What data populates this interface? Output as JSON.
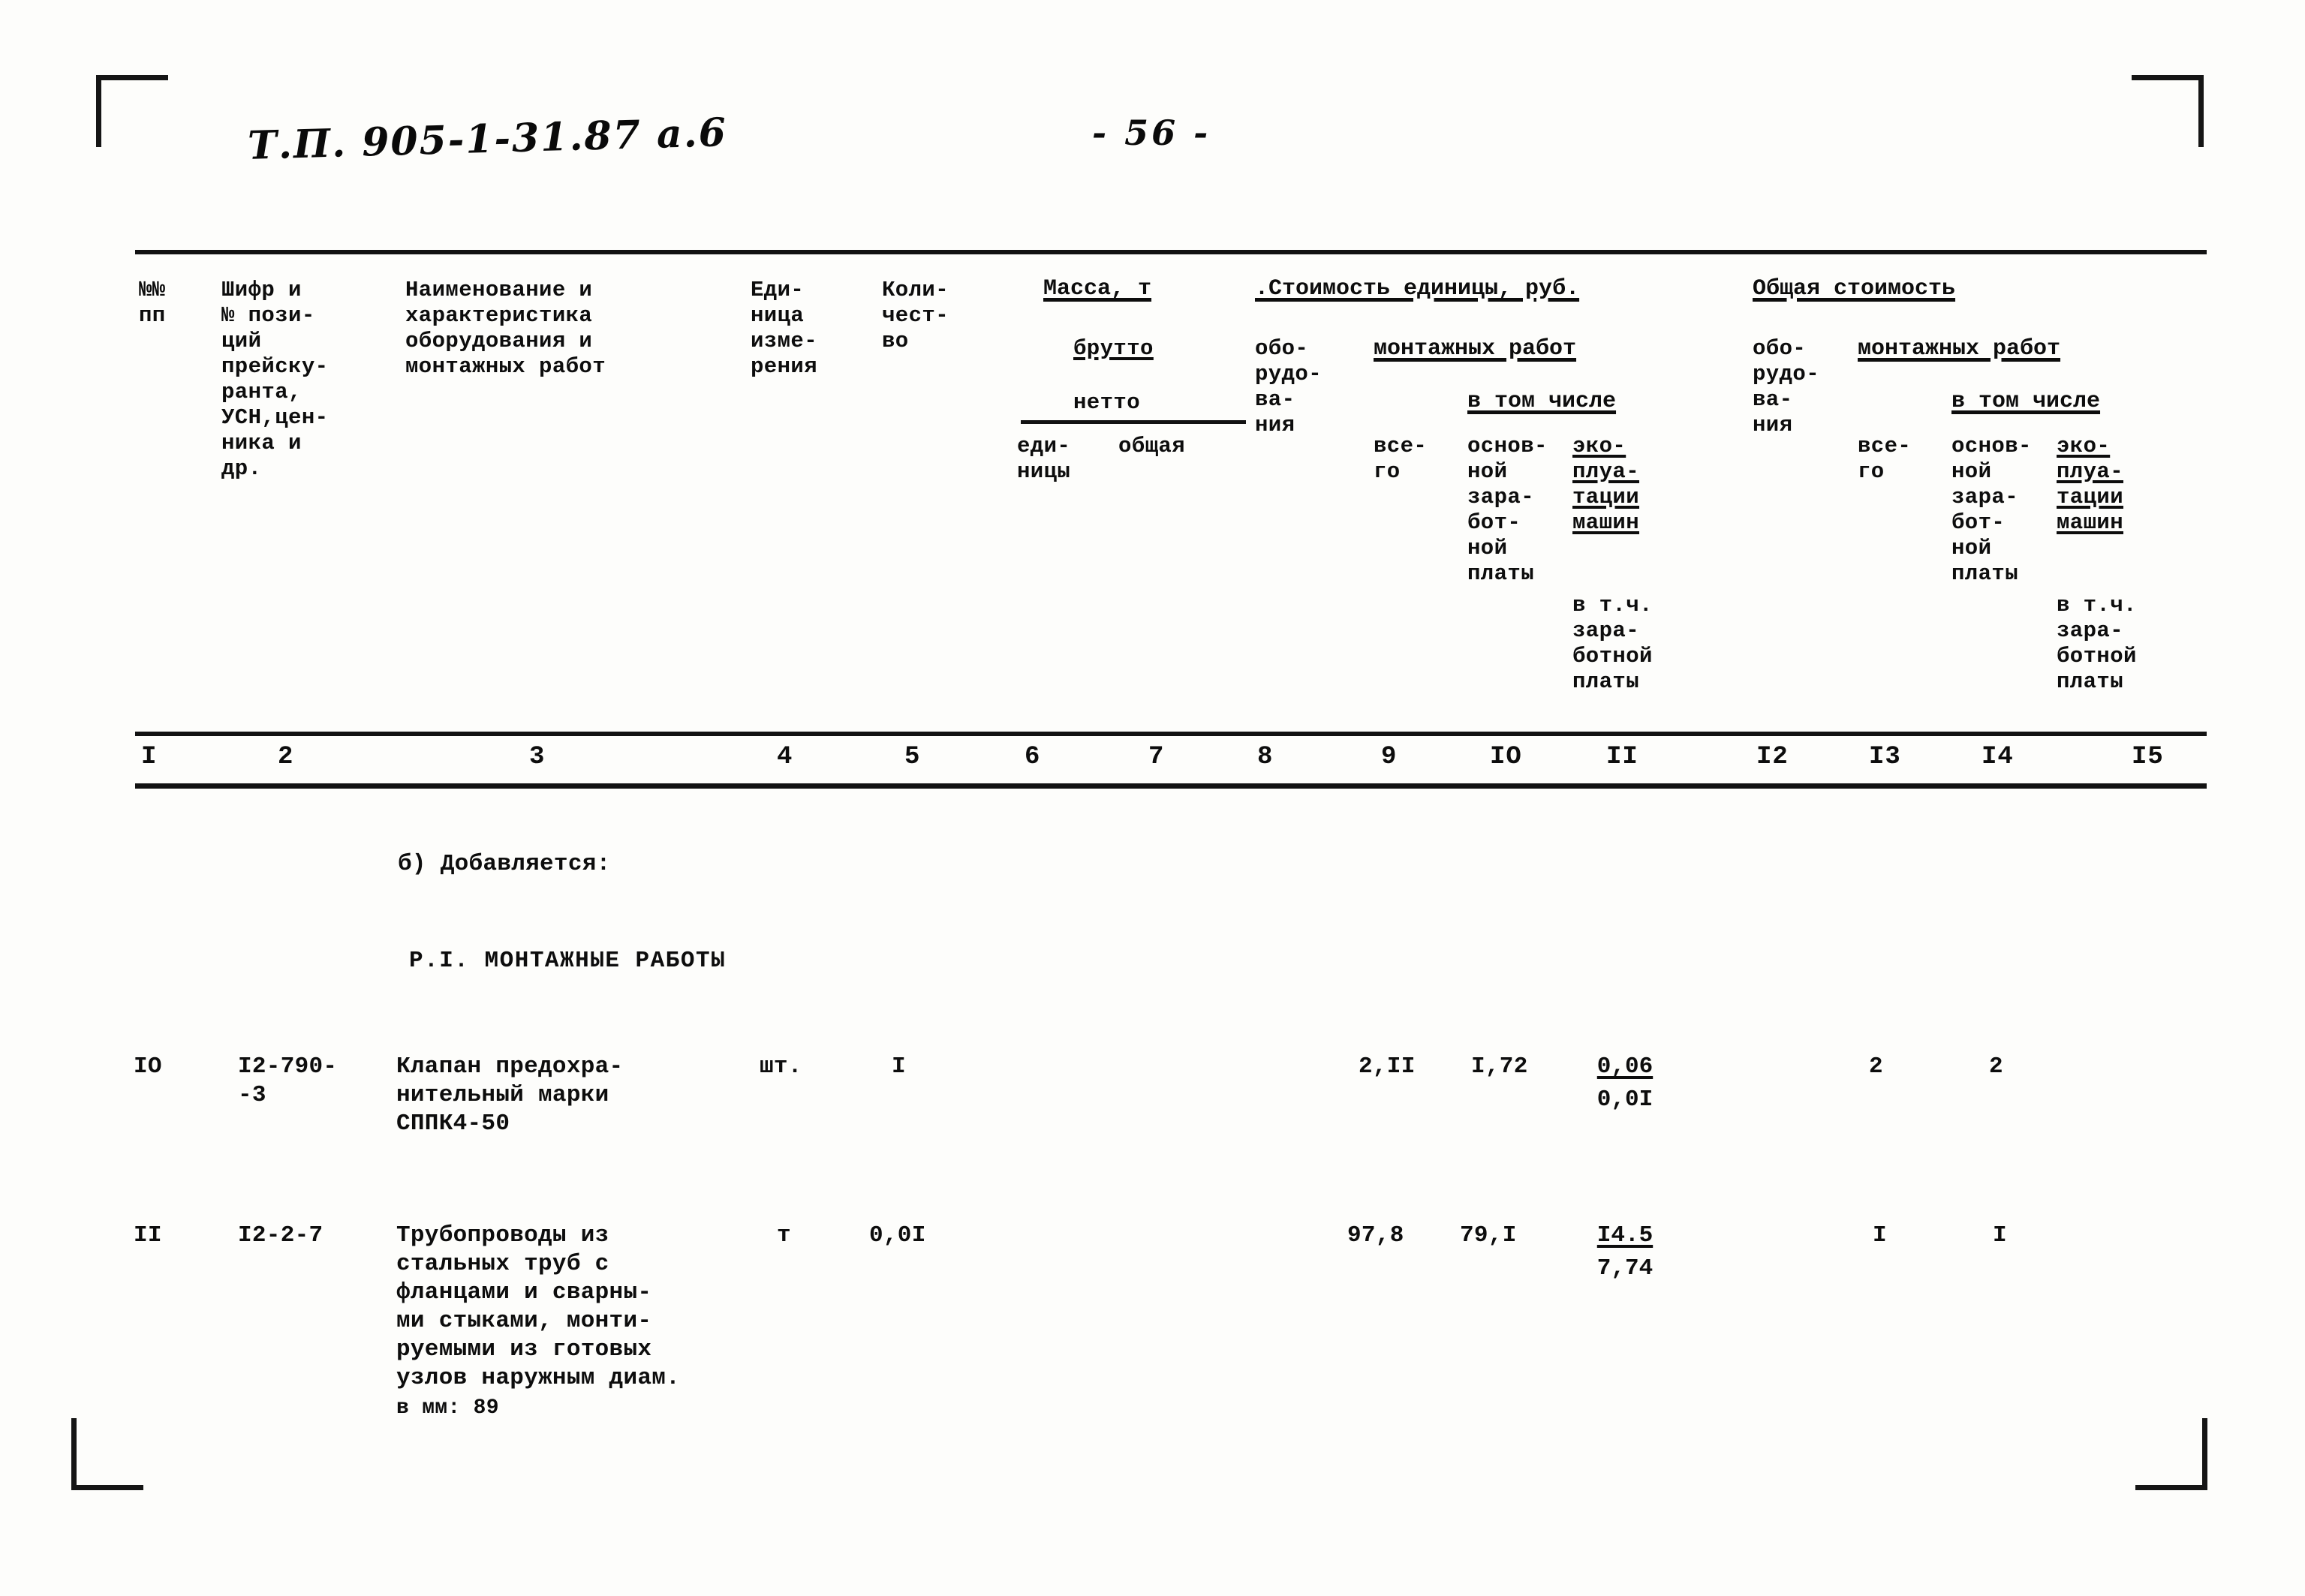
{
  "document": {
    "code": "Т.П. 905-1-31.87 а.6",
    "page_label": "- 56 -"
  },
  "table": {
    "headers": {
      "col1": "№№\nпп",
      "col2": "Шифр и\n№ пози-\nций\nпрейску-\nранта,\nУСН,цен-\nника и\nдр.",
      "col3": "Наименование и\nхарактеристика\nоборудования и\nмонтажных работ",
      "col4": "Еди-\nница\nизме-\nрения",
      "col5": "Коли-\nчест-\nво",
      "mass_group": "Масса, т",
      "mass_brutto": "брутто",
      "mass_netto": "нетто",
      "mass_unit": "еди-\nницы",
      "mass_total": "общая",
      "unit_cost_group": ".Стоимость единицы, руб.",
      "equipment_left": "обо-\nрудо-\nва-\nния",
      "install_left": "монтажных работ",
      "total_left": "все-\nго",
      "among_left": "в том числе",
      "basic_wage_left": "основ-\nной\nзара-\nбот-\nной\nплаты",
      "machine_left": "эко-\nплуа-\nтации\nмашин",
      "machine_wage_left": "в т.ч.\nзара-\nботной\nплаты",
      "total_cost_group": "Общая стоимость",
      "equipment_right": "обо-\nрудо-\nва-\nния",
      "install_right": "монтажных работ",
      "total_right": "все-\nго",
      "among_right": "в том числе",
      "basic_wage_right": "основ-\nной\nзара-\nбот-\nной\nплаты",
      "machine_right": "эко-\nплуа-\nтации\nмашин",
      "machine_wage_right": "в т.ч.\nзара-\nботной\nплаты"
    },
    "column_numbers": [
      "I",
      "2",
      "3",
      "4",
      "5",
      "6",
      "7",
      "8",
      "9",
      "IO",
      "II",
      "I2",
      "I3",
      "I4",
      "I5"
    ]
  },
  "body": {
    "section_note": "б) Добавляется:",
    "section_title": "Р.I. МОНТАЖНЫЕ РАБОТЫ",
    "rows": [
      {
        "no": "IO",
        "code": "I2-790-\n-3",
        "name": "Клапан предохра-\nнительный марки\nСППК4-50",
        "unit": "шт.",
        "qty": "I",
        "col9": "2,II",
        "col10": "I,72",
        "col11_top": "0,06",
        "col11_bot": "0,0I",
        "col13": "2",
        "col14": "2"
      },
      {
        "no": "II",
        "code": "I2-2-7",
        "name": "Трубопроводы из\nстальных труб с\nфланцами и сварны-\nми стыками, монти-\nруемыми из готовых\nузлов наружным диам.",
        "name_last": "в мм:      89",
        "unit": "т",
        "qty": "0,0I",
        "col9": "97,8",
        "col10": "79,I",
        "col11_top": "I4.5",
        "col11_bot": "7,74",
        "col13": "I",
        "col14": "I"
      }
    ]
  }
}
